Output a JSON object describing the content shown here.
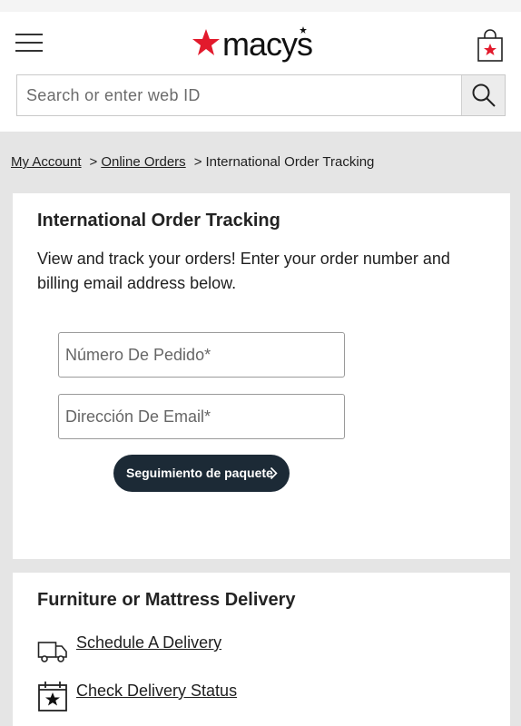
{
  "brand": {
    "name": "macy's",
    "accent_color": "#e21a2c"
  },
  "header": {
    "menu_icon": "hamburger-menu-icon",
    "bag_icon": "shopping-bag-star-icon",
    "search": {
      "placeholder": "Search or enter web ID",
      "value": "",
      "icon": "search-icon"
    }
  },
  "breadcrumb": {
    "items": [
      {
        "label": "My Account",
        "link": true
      },
      {
        "label": "Online Orders",
        "link": true
      },
      {
        "label": "International Order Tracking",
        "link": false
      }
    ],
    "separator": ">"
  },
  "tracking": {
    "title": "International Order Tracking",
    "description": "View and track your orders! Enter your order number and billing email address below.",
    "order_number_placeholder": "Número De Pedido*",
    "email_placeholder": "Dirección De Email*",
    "submit_label": "Seguimiento de paquete",
    "button_color": "#1c2a36"
  },
  "delivery": {
    "title": "Furniture or Mattress Delivery",
    "links": [
      {
        "label": "Schedule A Delivery",
        "icon": "delivery-truck-icon"
      },
      {
        "label": "Check Delivery Status",
        "icon": "calendar-star-icon"
      }
    ]
  }
}
